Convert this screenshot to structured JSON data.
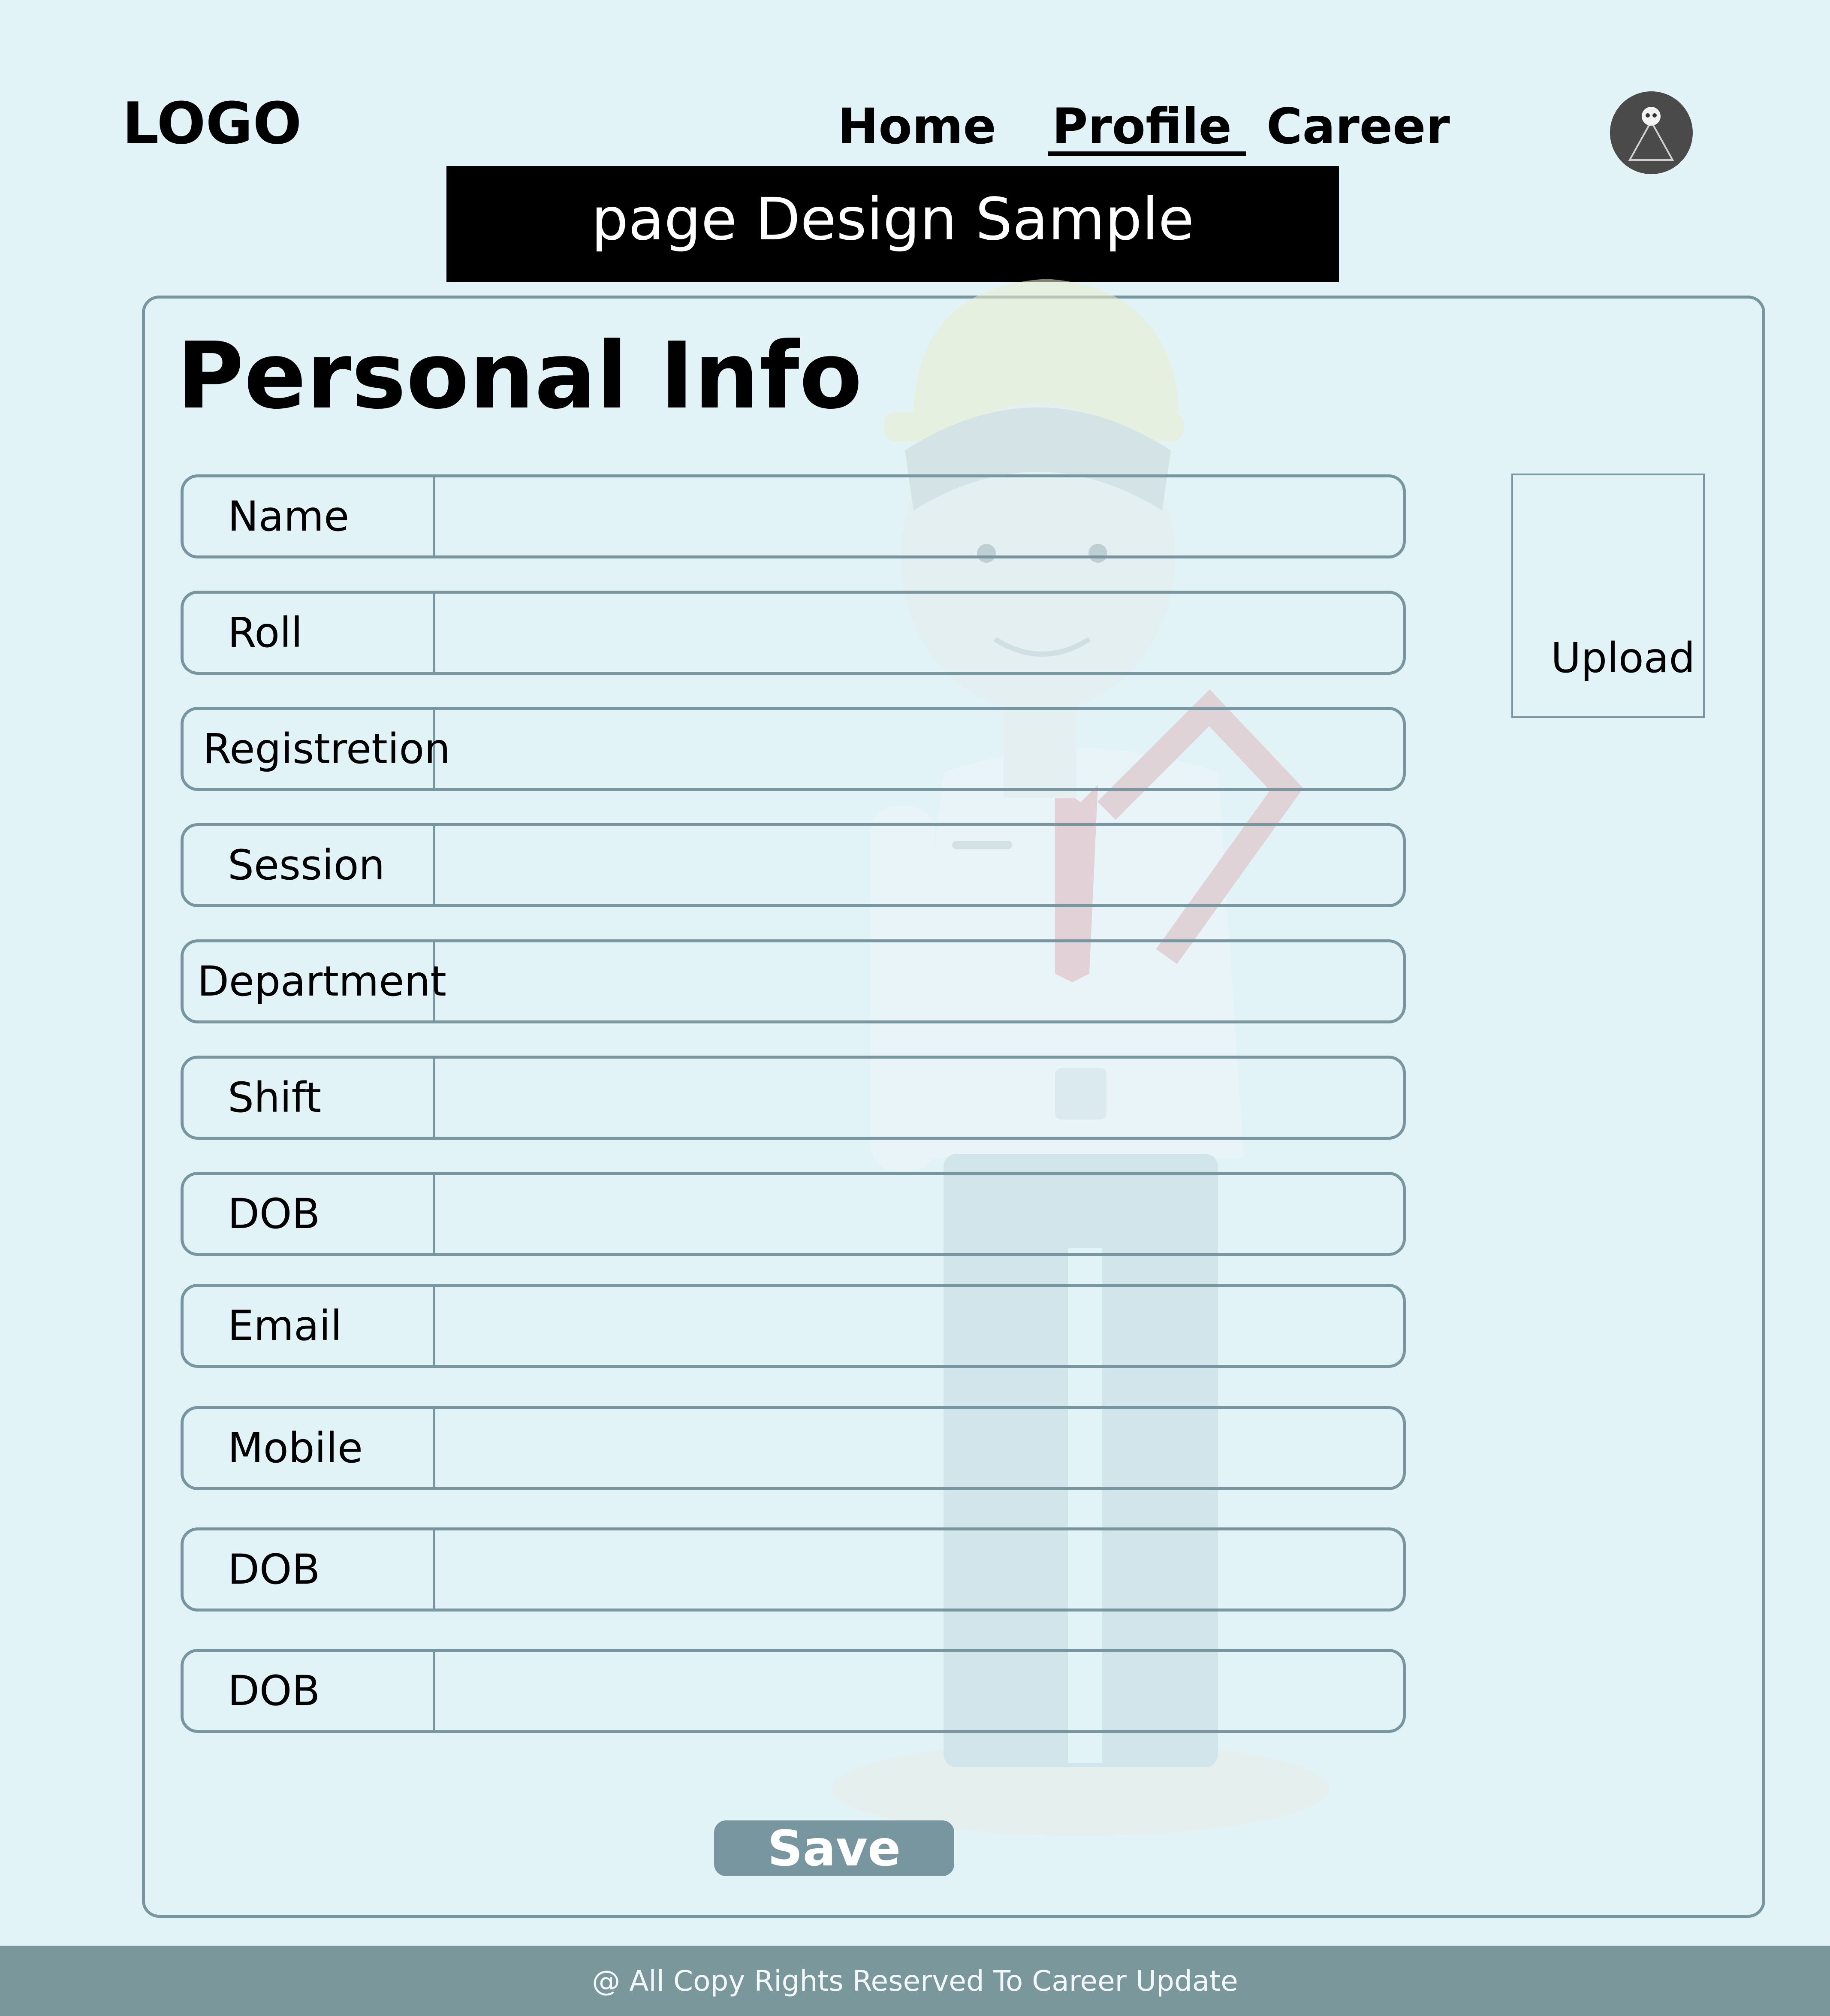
{
  "header": {
    "logo": "LOGO",
    "nav": {
      "home": "Home",
      "profile": "Profile",
      "career": "Career"
    },
    "active_nav": "Profile",
    "avatar_icon": "user-avatar-icon"
  },
  "banner": {
    "text": "page Design Sample"
  },
  "form": {
    "title": "Personal Info",
    "fields": [
      {
        "label": "Name",
        "value": ""
      },
      {
        "label": "Roll",
        "value": ""
      },
      {
        "label": "Registretion",
        "value": ""
      },
      {
        "label": "Session",
        "value": ""
      },
      {
        "label": "Department",
        "value": ""
      },
      {
        "label": "Shift",
        "value": ""
      },
      {
        "label": "DOB",
        "value": ""
      },
      {
        "label": "Email",
        "value": ""
      },
      {
        "label": "Mobile",
        "value": ""
      },
      {
        "label": "DOB",
        "value": ""
      },
      {
        "label": "DOB",
        "value": ""
      }
    ],
    "upload_label": "Upload",
    "save_label": "Save"
  },
  "footer": {
    "text": "@ All Copy Rights Reserved To Career Update"
  },
  "colors": {
    "background": "#e2f3f8",
    "border": "#7896a0",
    "footer": "#7a979c",
    "banner": "#000000"
  }
}
